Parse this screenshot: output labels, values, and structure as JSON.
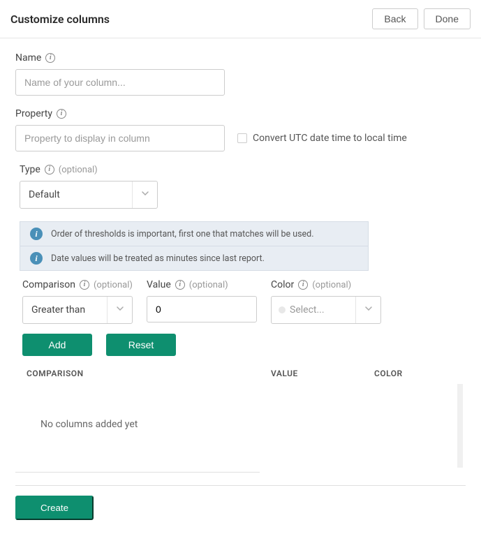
{
  "header": {
    "title": "Customize columns",
    "back": "Back",
    "done": "Done"
  },
  "name": {
    "label": "Name",
    "placeholder": "Name of your column..."
  },
  "property": {
    "label": "Property",
    "placeholder": "Property to display in column",
    "checkbox": "Convert UTC date time to local time"
  },
  "type": {
    "label": "Type",
    "optional": "(optional)",
    "value": "Default"
  },
  "banners": {
    "order": "Order of thresholds is important, first one that matches will be used.",
    "date": "Date values will be treated as minutes since last report."
  },
  "comparison": {
    "label": "Comparison",
    "optional": "(optional)",
    "value": "Greater than"
  },
  "value": {
    "label": "Value",
    "optional": "(optional)",
    "value": "0"
  },
  "color": {
    "label": "Color",
    "optional": "(optional)",
    "placeholder": "Select..."
  },
  "actions": {
    "add": "Add",
    "reset": "Reset"
  },
  "table": {
    "headers": {
      "comparison": "COMPARISON",
      "value": "VALUE",
      "color": "COLOR"
    },
    "empty": "No columns added yet"
  },
  "footer": {
    "create": "Create"
  }
}
